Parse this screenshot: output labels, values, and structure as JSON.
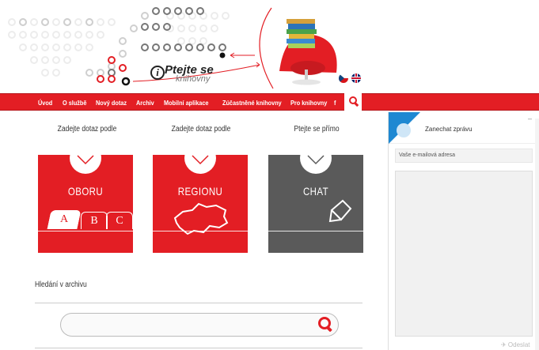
{
  "header": {
    "logo_title": "Ptejte se",
    "logo_subtitle": "knihovny",
    "logo_i": "i",
    "languages": [
      "cs",
      "en"
    ]
  },
  "nav": {
    "items": [
      "Úvod",
      "O službě",
      "Nový dotaz",
      "Archiv",
      "Mobilní aplikace",
      "Zúčastněné knihovny",
      "Pro knihovny",
      "f"
    ],
    "search_icon": "search-icon"
  },
  "main": {
    "columns": [
      {
        "heading": "Zadejte dotaz podle",
        "label": "OBORU"
      },
      {
        "heading": "Zadejte dotaz podle",
        "label": "REGIONU"
      },
      {
        "heading": "Ptejte se přímo",
        "label": "CHAT"
      }
    ],
    "abc_tabs": [
      "A",
      "B",
      "C"
    ],
    "archive_label": "Hledání v archivu",
    "archive_search_placeholder": ""
  },
  "chat": {
    "title": "Zanechat zprávu",
    "minimize": "–",
    "email_placeholder": "Vaše e-mailová adresa",
    "send_label": "✈ Odeslat"
  },
  "colors": {
    "brand_red": "#e31e24",
    "chat_blue": "#1e88d2",
    "dark_tile": "#5a5a5a"
  }
}
